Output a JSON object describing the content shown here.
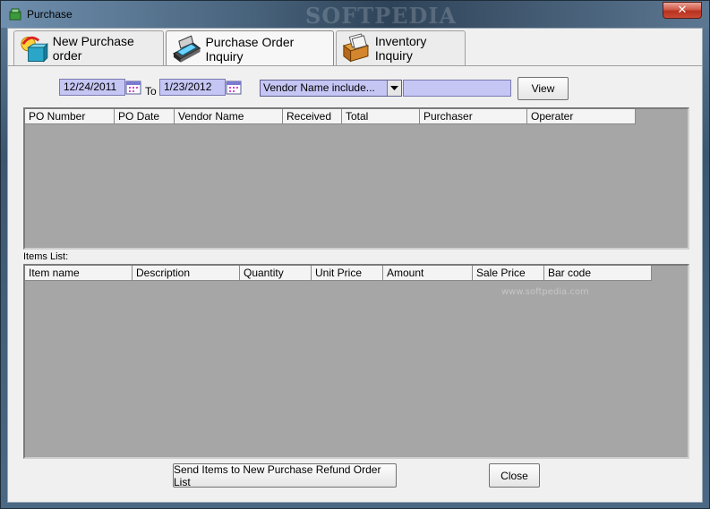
{
  "window": {
    "title": "Purchase",
    "watermark": "SOFTPEDIA",
    "close_glyph": "✕"
  },
  "tabs": [
    {
      "label": "New Purchase order",
      "icon": "new-order-icon"
    },
    {
      "label": "Purchase Order Inquiry",
      "icon": "scanner-icon"
    },
    {
      "label": "Inventory Inquiry",
      "icon": "card-box-icon"
    }
  ],
  "filters": {
    "date_from": "12/24/2011",
    "to_label": "To",
    "date_to": "1/23/2012",
    "vendor_filter": "Vendor Name include...",
    "vendor_text": "",
    "view_label": "View"
  },
  "orders_grid": {
    "columns": [
      "PO Number",
      "PO Date",
      "Vendor Name",
      "Received",
      "Total",
      "Purchaser",
      "Operater"
    ],
    "rows": []
  },
  "items": {
    "label": "Items List:",
    "columns": [
      "Item name",
      "Description",
      "Quantity",
      "Unit Price",
      "Amount",
      "Sale Price",
      "Bar code"
    ],
    "rows": [],
    "watermark": "www.softpedia.com"
  },
  "footer": {
    "send_label": "Send Items to New Purchase Refund Order List",
    "close_label": "Close"
  },
  "colors": {
    "field_bg": "#c6c6f5",
    "grid_bg": "#a6a6a6",
    "dialog_bg": "#f0f0f0"
  }
}
